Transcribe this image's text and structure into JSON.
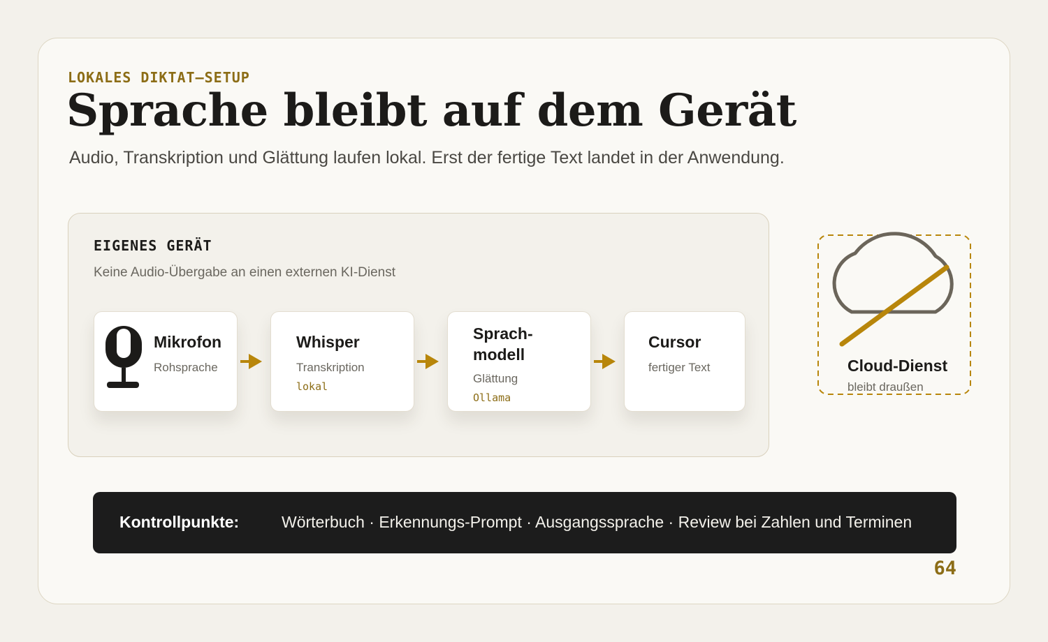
{
  "header": {
    "kicker": "LOKALES DIKTAT–SETUP",
    "title": "Sprache bleibt auf dem Gerät",
    "subtitle": "Audio, Transkription und Glättung laufen lokal. Erst der fertige Text landet in der Anwendung."
  },
  "device": {
    "title": "EIGENES GERÄT",
    "subtitle": "Keine Audio-Übergabe an einen externen KI-Dienst"
  },
  "pipeline": [
    {
      "title": "Mikrofon",
      "sub": "Rohsprache",
      "icon": "microphone-icon"
    },
    {
      "title": "Whisper",
      "sub": "Transkription",
      "tag": "lokal"
    },
    {
      "title_line1": "Sprach-",
      "title_line2": "modell",
      "sub": "Glättung",
      "tag": "Ollama"
    },
    {
      "title": "Cursor",
      "sub": "fertiger Text"
    }
  ],
  "cloud": {
    "title": "Cloud-Dienst",
    "subtitle": "bleibt draußen",
    "icon": "crossed-cloud-icon"
  },
  "controls": {
    "label": "Kontrollpunkte:",
    "items": "Wörterbuch · Erkennungs-Prompt · Ausgangssprache · Review bei Zahlen und Terminen"
  },
  "page_number": "64",
  "colors": {
    "accent": "#b8860b",
    "kicker": "#8c6d16",
    "background": "#f3f1eb",
    "dark_bar": "#1c1c1c"
  }
}
